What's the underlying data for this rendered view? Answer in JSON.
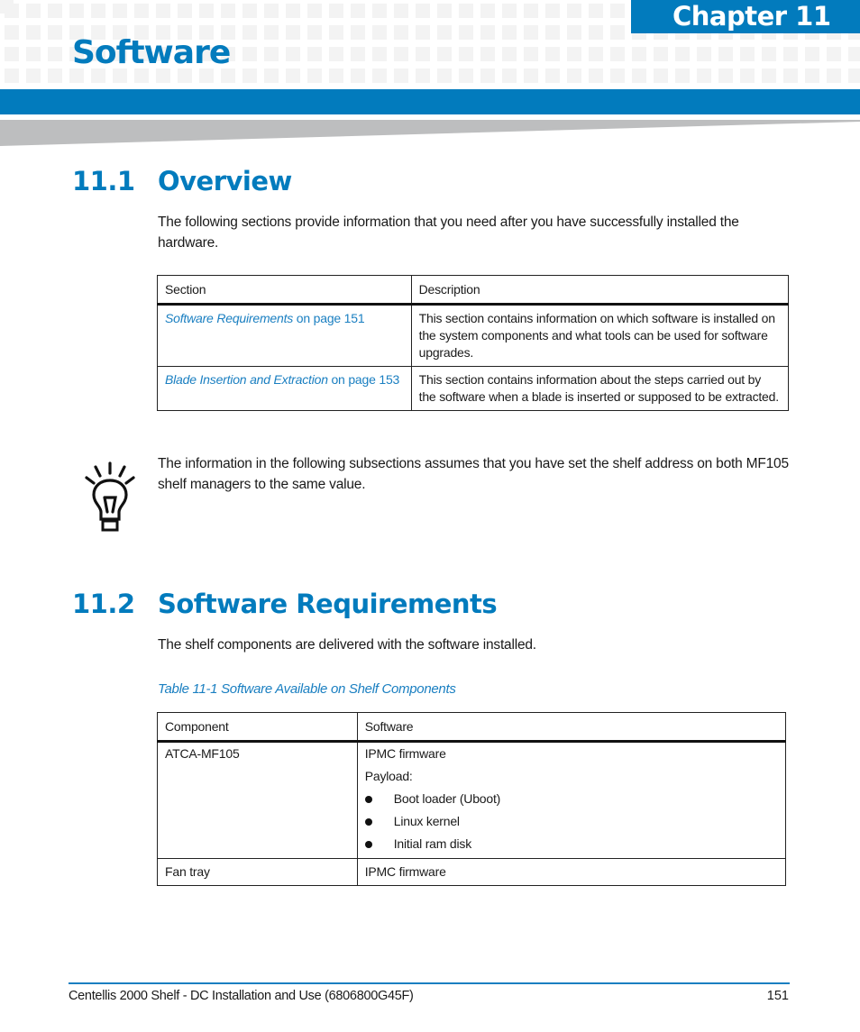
{
  "header": {
    "chapter_label": "Chapter 11",
    "chapter_title": "Software",
    "brand_color": "#027bbd",
    "wedge_color": "#bdbebf",
    "grid_color": "#f3f3f3"
  },
  "sections": [
    {
      "number": "11.1",
      "title": "Overview",
      "intro": "The following sections provide information that you need after you have successfully installed the hardware.",
      "table": {
        "headers": [
          "Section",
          "Description"
        ],
        "rows": [
          {
            "link_italic": "Software Requirements",
            "link_suffix": " on page 151",
            "description": "This section contains information on which software is installed on the system components and what tools can be used for software upgrades."
          },
          {
            "link_italic": "Blade Insertion and Extraction",
            "link_suffix": " on page 153",
            "description": "This section contains information about the steps carried out by the software when a blade is inserted or supposed to be extracted."
          }
        ]
      },
      "tip": {
        "icon": "lightbulb-icon",
        "text": "The information in the following subsections assumes that you have set the shelf address on both MF105 shelf managers to the same value."
      }
    },
    {
      "number": "11.2",
      "title": "Software Requirements",
      "intro": "The shelf components are delivered with the software installed.",
      "table_caption": "Table 11-1 Software Available on Shelf Components",
      "table": {
        "headers": [
          "Component",
          "Software"
        ],
        "rows": [
          {
            "component": "ATCA-MF105",
            "software_lines": [
              "IPMC firmware",
              "Payload:"
            ],
            "bullets": [
              "Boot loader (Uboot)",
              "Linux kernel",
              "Initial ram disk"
            ]
          },
          {
            "component": "Fan tray",
            "software_lines": [
              "IPMC firmware"
            ],
            "bullets": []
          }
        ]
      }
    }
  ],
  "footer": {
    "document_title": "Centellis 2000 Shelf - DC Installation and Use (6806800G45F)",
    "page_number": "151"
  }
}
